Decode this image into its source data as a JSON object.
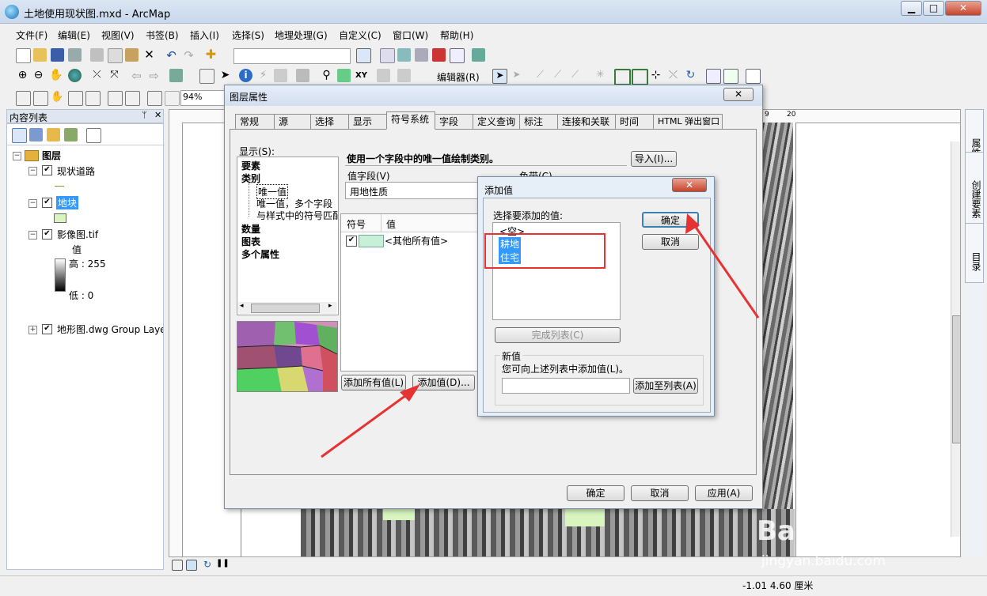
{
  "window": {
    "title": "土地使用现状图.mxd - ArcMap",
    "minimize": "▭",
    "maximize": "□",
    "close": "✕"
  },
  "menu": [
    "文件(F)",
    "编辑(E)",
    "视图(V)",
    "书签(B)",
    "插入(I)",
    "选择(S)",
    "地理处理(G)",
    "自定义(C)",
    "窗口(W)",
    "帮助(H)"
  ],
  "toolbar": {
    "zoom_value": "94%",
    "editor_label": "编辑器(R)"
  },
  "toc": {
    "header": "内容列表",
    "pin": "ᛘ",
    "close": "✕",
    "root": "图层",
    "layers": [
      {
        "name": "现状道路"
      },
      {
        "name": "地块"
      },
      {
        "name": "影像图.tif",
        "legend_title": "值",
        "high": "高 : 255",
        "low": "低 : 0"
      },
      {
        "name": "地形图.dwg Group Layer"
      }
    ]
  },
  "map": {
    "ruler_marks": [
      "9",
      "20"
    ]
  },
  "right_dock": [
    "属性",
    "创建要素",
    "目录"
  ],
  "status": {
    "coords": "-1.01  4.60 厘米"
  },
  "layer_props": {
    "title": "图层属性",
    "tabs": [
      "常规",
      "源",
      "选择",
      "显示",
      "符号系统",
      "字段",
      "定义查询",
      "标注",
      "连接和关联",
      "时间",
      "HTML 弹出窗口"
    ],
    "show_label": "显示(S):",
    "tree": {
      "features": "要素",
      "categories": "类别",
      "unique": "唯一值",
      "unique_many": "唯一值，多个字段",
      "match_style": "与样式中的符号匹配",
      "quantities": "数量",
      "charts": "图表",
      "multiple": "多个属性"
    },
    "description": "使用一个字段中的唯一值绘制类别。",
    "import_btn": "导入(I)...",
    "value_field_label": "值字段(V)",
    "value_field": "用地性质",
    "color_ramp_label": "色带(C)",
    "col_symbol": "符号",
    "col_value": "值",
    "row_other": "<其他所有值>",
    "add_all_btn": "添加所有值(L)",
    "add_value_btn": "添加值(D)...",
    "ok": "确定",
    "cancel": "取消",
    "apply": "应用(A)"
  },
  "add_value": {
    "title": "添加值",
    "select_label": "选择要添加的值:",
    "values": [
      "<空>",
      "耕地",
      "住宅"
    ],
    "complete_btn": "完成列表(C)",
    "new_value_group": "新值",
    "new_value_hint": "您可向上述列表中添加值(L)。",
    "add_to_list_btn": "添加至列表(A)",
    "ok": "确定",
    "cancel": "取消",
    "close": "✕"
  },
  "watermark": {
    "main": "Baidu经验",
    "sub": "jingyan.baidu.com"
  },
  "colors": {
    "selection": "#3399ff",
    "annotation": "#e63232",
    "symbol_fill": "#c8f0d8"
  }
}
